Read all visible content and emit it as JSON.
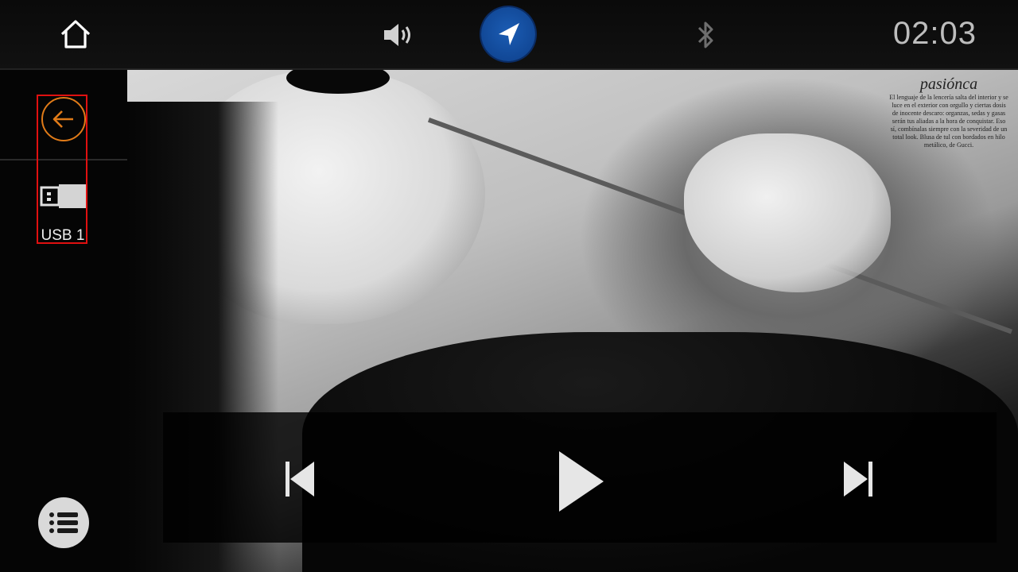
{
  "topbar": {
    "home_icon": "home-icon",
    "volume_icon": "volume-icon",
    "navigation_icon": "navigation-arrow-icon",
    "bluetooth_icon": "bluetooth-icon",
    "clock": "02:03",
    "nav_color": "#0d3f8a"
  },
  "sidebar": {
    "back_icon": "back-arrow-icon",
    "accent_color": "#e07b18",
    "selection_color": "#e01010",
    "source": {
      "icon": "usb-icon",
      "label": "USB 1"
    },
    "list_icon": "list-icon"
  },
  "artwork": {
    "headline": "pasiónca",
    "text": "El lenguaje de la lencería salta del interior y se luce en el exterior con orgullo y ciertas dosis de inocente descaro: organzas, sedas y gasas serán tus aliadas a la hora de conquistar. Eso sí, combínalas siempre con la severidad de un total look. Blusa de tul con bordados en hilo metálico, de Gucci."
  },
  "controls": {
    "prev_icon": "previous-track-icon",
    "play_icon": "play-icon",
    "next_icon": "next-track-icon"
  }
}
